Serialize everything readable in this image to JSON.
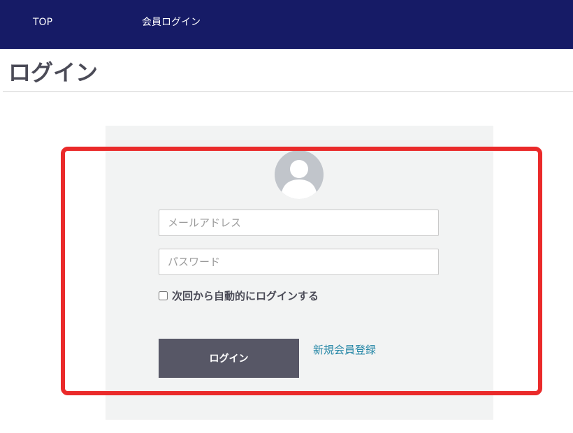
{
  "nav": {
    "items": [
      {
        "label": "TOP"
      },
      {
        "label": "会員ログイン"
      }
    ],
    "background": "#161b66"
  },
  "page": {
    "title": "ログイン"
  },
  "form": {
    "avatar_icon": "user-silhouette-icon",
    "email_placeholder": "メールアドレス",
    "email_value": "",
    "password_placeholder": "パスワード",
    "password_value": "",
    "remember_label": "次回から自動的にログインする",
    "remember_checked": false,
    "login_button_label": "ログイン",
    "register_link_label": "新規会員登録"
  },
  "colors": {
    "panel": "#f2f3f3",
    "button": "#575766",
    "link": "#2486a6",
    "highlight": "#ea2a2a"
  }
}
